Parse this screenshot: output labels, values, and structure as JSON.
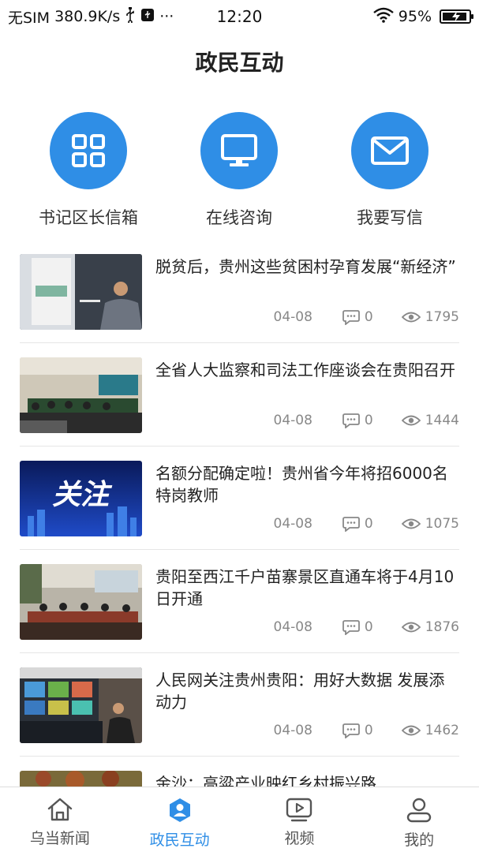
{
  "status_bar": {
    "carrier": "无SIM",
    "speed": "380.9K/s",
    "more": "···",
    "time": "12:20",
    "battery": "95%",
    "battery_level": 0.95
  },
  "page_title": "政民互动",
  "quick_actions": [
    {
      "label": "书记区长信箱",
      "icon": "grid-icon"
    },
    {
      "label": "在线咨询",
      "icon": "monitor-icon"
    },
    {
      "label": "我要写信",
      "icon": "mail-icon"
    }
  ],
  "news": [
    {
      "title": "脱贫后，贵州这些贫困村孕育发展“新经济”",
      "date": "04-08",
      "comments": "0",
      "views": "1795"
    },
    {
      "title": "全省人大监察和司法工作座谈会在贵阳召开",
      "date": "04-08",
      "comments": "0",
      "views": "1444"
    },
    {
      "title": "名额分配确定啦！贵州省今年将招6000名特岗教师",
      "date": "04-08",
      "comments": "0",
      "views": "1075",
      "thumb_text": "关注"
    },
    {
      "title": "贵阳至西江千户苗寨景区直通车将于4月10日开通",
      "date": "04-08",
      "comments": "0",
      "views": "1876"
    },
    {
      "title": "人民网关注贵州贵阳：用好大数据 发展添动力",
      "date": "04-08",
      "comments": "0",
      "views": "1462"
    },
    {
      "title": "金沙：高粱产业映红乡村振兴路"
    }
  ],
  "bottom_nav": [
    {
      "label": "乌当新闻",
      "icon": "home-icon"
    },
    {
      "label": "政民互动",
      "icon": "interaction-icon",
      "active": true
    },
    {
      "label": "视频",
      "icon": "video-icon"
    },
    {
      "label": "我的",
      "icon": "user-icon"
    }
  ],
  "colors": {
    "accent": "#2f8ee6",
    "meta": "#888888"
  }
}
